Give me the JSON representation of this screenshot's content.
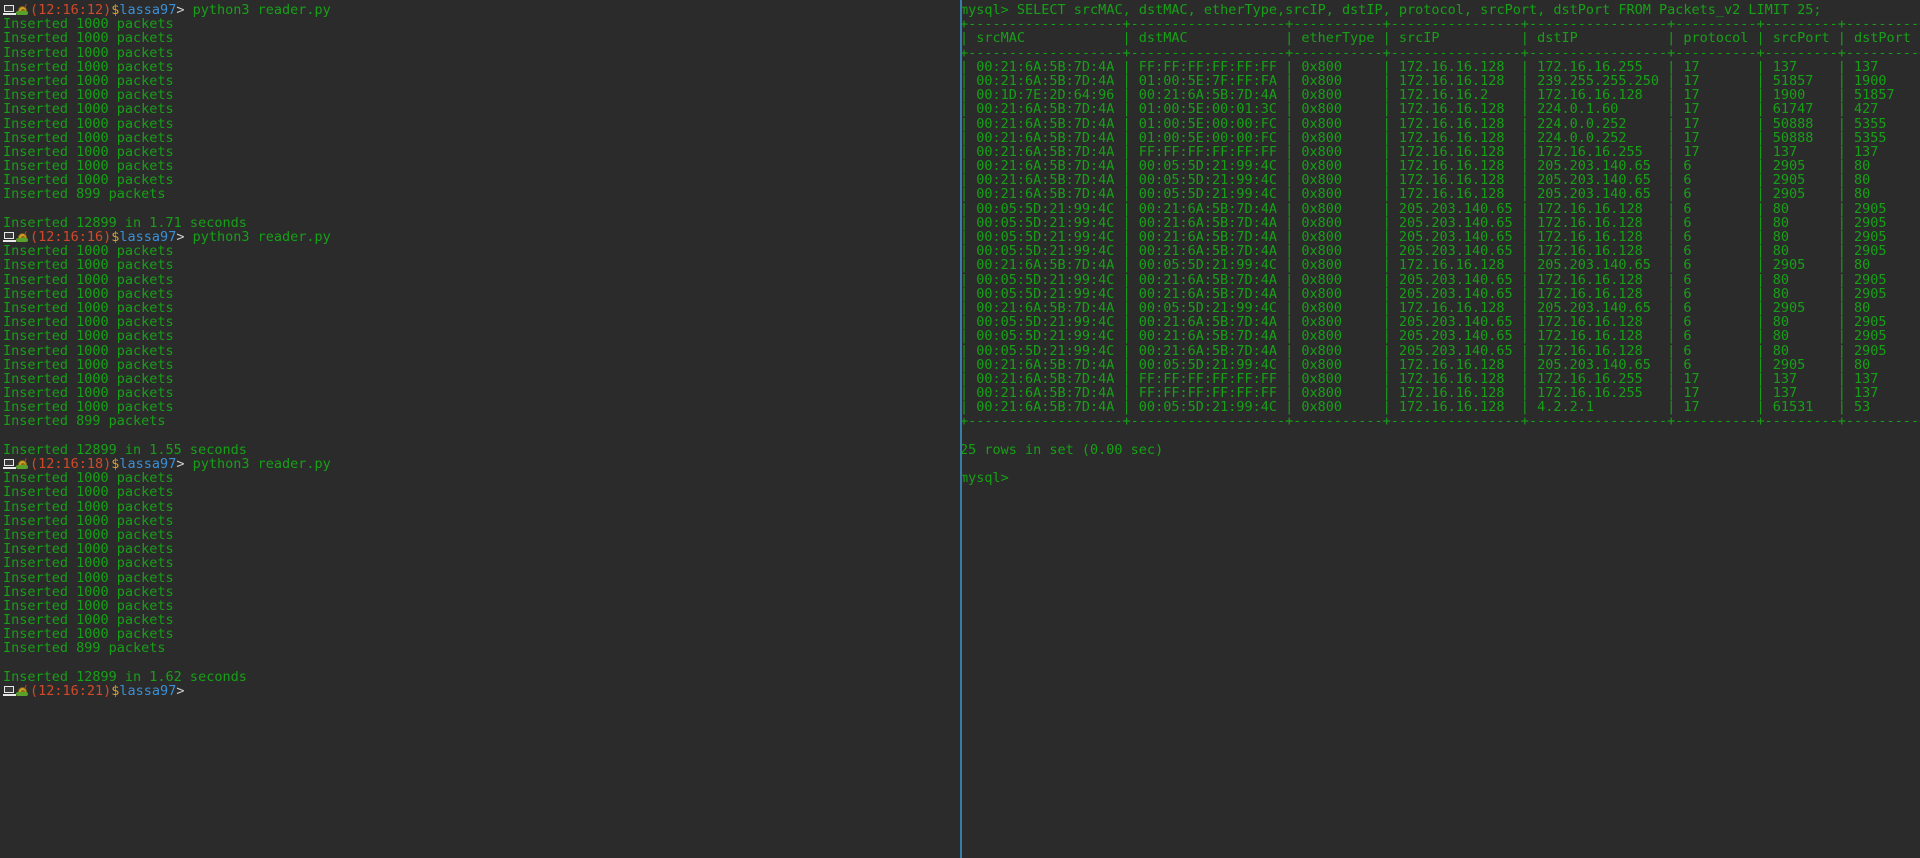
{
  "terminal": {
    "background_color": "#2b2b2b",
    "foreground_color": "#17a017",
    "divider_color": "#3a7ca8",
    "prompt_time_color": "#d04a2a",
    "prompt_user_color": "#3b8fd6",
    "prompt_dollar_color": "#d6a03a"
  },
  "left_pane": {
    "name": "python-reader-pane",
    "icons": [
      "laptop-icon",
      "snail-icon"
    ],
    "blocks": [
      {
        "prompt": {
          "time": "(12:16:12)",
          "dollar": "$",
          "user": "lassa97",
          "arrow": ">",
          "command": "python3 reader.py"
        },
        "output": [
          "Inserted 1000 packets",
          "Inserted 1000 packets",
          "Inserted 1000 packets",
          "Inserted 1000 packets",
          "Inserted 1000 packets",
          "Inserted 1000 packets",
          "Inserted 1000 packets",
          "Inserted 1000 packets",
          "Inserted 1000 packets",
          "Inserted 1000 packets",
          "Inserted 1000 packets",
          "Inserted 1000 packets",
          "Inserted 899 packets"
        ],
        "summary": "Inserted 12899 in 1.71 seconds"
      },
      {
        "prompt": {
          "time": "(12:16:16)",
          "dollar": "$",
          "user": "lassa97",
          "arrow": ">",
          "command": "python3 reader.py"
        },
        "output": [
          "Inserted 1000 packets",
          "Inserted 1000 packets",
          "Inserted 1000 packets",
          "Inserted 1000 packets",
          "Inserted 1000 packets",
          "Inserted 1000 packets",
          "Inserted 1000 packets",
          "Inserted 1000 packets",
          "Inserted 1000 packets",
          "Inserted 1000 packets",
          "Inserted 1000 packets",
          "Inserted 1000 packets",
          "Inserted 899 packets"
        ],
        "summary": "Inserted 12899 in 1.55 seconds"
      },
      {
        "prompt": {
          "time": "(12:16:18)",
          "dollar": "$",
          "user": "lassa97",
          "arrow": ">",
          "command": "python3 reader.py"
        },
        "output": [
          "Inserted 1000 packets",
          "Inserted 1000 packets",
          "Inserted 1000 packets",
          "Inserted 1000 packets",
          "Inserted 1000 packets",
          "Inserted 1000 packets",
          "Inserted 1000 packets",
          "Inserted 1000 packets",
          "Inserted 1000 packets",
          "Inserted 1000 packets",
          "Inserted 1000 packets",
          "Inserted 1000 packets",
          "Inserted 899 packets"
        ],
        "summary": "Inserted 12899 in 1.62 seconds"
      }
    ],
    "final_prompt": {
      "time": "(12:16:21)",
      "dollar": "$",
      "user": "lassa97",
      "arrow": ">",
      "command": ""
    }
  },
  "right_pane": {
    "name": "mysql-client-pane",
    "query_prompt": "mysql>",
    "query": " SELECT srcMAC, dstMAC, etherType,srcIP, dstIP, protocol, srcPort, dstPort FROM Packets_v2 LIMIT 25;",
    "rule": "+-------------------+-------------------+-----------+----------------+-----------------+----------+---------+---------+",
    "header_row": "| srcMAC            | dstMAC            | etherType | srcIP          | dstIP           | protocol | srcPort | dstPort |",
    "columns": [
      "srcMAC",
      "dstMAC",
      "etherType",
      "srcIP",
      "dstIP",
      "protocol",
      "srcPort",
      "dstPort"
    ],
    "rows": [
      [
        "00:21:6A:5B:7D:4A",
        "FF:FF:FF:FF:FF:FF",
        "0x800",
        "172.16.16.128",
        "172.16.16.255",
        "17",
        "137",
        "137"
      ],
      [
        "00:21:6A:5B:7D:4A",
        "01:00:5E:7F:FF:FA",
        "0x800",
        "172.16.16.128",
        "239.255.255.250",
        "17",
        "51857",
        "1900"
      ],
      [
        "00:1D:7E:2D:64:96",
        "00:21:6A:5B:7D:4A",
        "0x800",
        "172.16.16.2",
        "172.16.16.128",
        "17",
        "1900",
        "51857"
      ],
      [
        "00:21:6A:5B:7D:4A",
        "01:00:5E:00:01:3C",
        "0x800",
        "172.16.16.128",
        "224.0.1.60",
        "17",
        "61747",
        "427"
      ],
      [
        "00:21:6A:5B:7D:4A",
        "01:00:5E:00:00:FC",
        "0x800",
        "172.16.16.128",
        "224.0.0.252",
        "17",
        "50888",
        "5355"
      ],
      [
        "00:21:6A:5B:7D:4A",
        "01:00:5E:00:00:FC",
        "0x800",
        "172.16.16.128",
        "224.0.0.252",
        "17",
        "50888",
        "5355"
      ],
      [
        "00:21:6A:5B:7D:4A",
        "FF:FF:FF:FF:FF:FF",
        "0x800",
        "172.16.16.128",
        "172.16.16.255",
        "17",
        "137",
        "137"
      ],
      [
        "00:21:6A:5B:7D:4A",
        "00:05:5D:21:99:4C",
        "0x800",
        "172.16.16.128",
        "205.203.140.65",
        "6",
        "2905",
        "80"
      ],
      [
        "00:21:6A:5B:7D:4A",
        "00:05:5D:21:99:4C",
        "0x800",
        "172.16.16.128",
        "205.203.140.65",
        "6",
        "2905",
        "80"
      ],
      [
        "00:21:6A:5B:7D:4A",
        "00:05:5D:21:99:4C",
        "0x800",
        "172.16.16.128",
        "205.203.140.65",
        "6",
        "2905",
        "80"
      ],
      [
        "00:05:5D:21:99:4C",
        "00:21:6A:5B:7D:4A",
        "0x800",
        "205.203.140.65",
        "172.16.16.128",
        "6",
        "80",
        "2905"
      ],
      [
        "00:05:5D:21:99:4C",
        "00:21:6A:5B:7D:4A",
        "0x800",
        "205.203.140.65",
        "172.16.16.128",
        "6",
        "80",
        "2905"
      ],
      [
        "00:05:5D:21:99:4C",
        "00:21:6A:5B:7D:4A",
        "0x800",
        "205.203.140.65",
        "172.16.16.128",
        "6",
        "80",
        "2905"
      ],
      [
        "00:05:5D:21:99:4C",
        "00:21:6A:5B:7D:4A",
        "0x800",
        "205.203.140.65",
        "172.16.16.128",
        "6",
        "80",
        "2905"
      ],
      [
        "00:21:6A:5B:7D:4A",
        "00:05:5D:21:99:4C",
        "0x800",
        "172.16.16.128",
        "205.203.140.65",
        "6",
        "2905",
        "80"
      ],
      [
        "00:05:5D:21:99:4C",
        "00:21:6A:5B:7D:4A",
        "0x800",
        "205.203.140.65",
        "172.16.16.128",
        "6",
        "80",
        "2905"
      ],
      [
        "00:05:5D:21:99:4C",
        "00:21:6A:5B:7D:4A",
        "0x800",
        "205.203.140.65",
        "172.16.16.128",
        "6",
        "80",
        "2905"
      ],
      [
        "00:21:6A:5B:7D:4A",
        "00:05:5D:21:99:4C",
        "0x800",
        "172.16.16.128",
        "205.203.140.65",
        "6",
        "2905",
        "80"
      ],
      [
        "00:05:5D:21:99:4C",
        "00:21:6A:5B:7D:4A",
        "0x800",
        "205.203.140.65",
        "172.16.16.128",
        "6",
        "80",
        "2905"
      ],
      [
        "00:05:5D:21:99:4C",
        "00:21:6A:5B:7D:4A",
        "0x800",
        "205.203.140.65",
        "172.16.16.128",
        "6",
        "80",
        "2905"
      ],
      [
        "00:05:5D:21:99:4C",
        "00:21:6A:5B:7D:4A",
        "0x800",
        "205.203.140.65",
        "172.16.16.128",
        "6",
        "80",
        "2905"
      ],
      [
        "00:21:6A:5B:7D:4A",
        "00:05:5D:21:99:4C",
        "0x800",
        "172.16.16.128",
        "205.203.140.65",
        "6",
        "2905",
        "80"
      ],
      [
        "00:21:6A:5B:7D:4A",
        "FF:FF:FF:FF:FF:FF",
        "0x800",
        "172.16.16.128",
        "172.16.16.255",
        "17",
        "137",
        "137"
      ],
      [
        "00:21:6A:5B:7D:4A",
        "FF:FF:FF:FF:FF:FF",
        "0x800",
        "172.16.16.128",
        "172.16.16.255",
        "17",
        "137",
        "137"
      ],
      [
        "00:21:6A:5B:7D:4A",
        "00:05:5D:21:99:4C",
        "0x800",
        "172.16.16.128",
        "4.2.2.1",
        "17",
        "61531",
        "53"
      ]
    ],
    "result_status": "25 rows in set (0.00 sec)",
    "final_prompt": "mysql>"
  }
}
